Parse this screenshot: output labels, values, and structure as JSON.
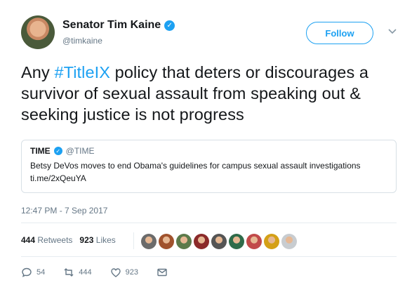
{
  "author": {
    "name": "Senator Tim Kaine",
    "handle": "@timkaine"
  },
  "follow_label": "Follow",
  "tweet": {
    "prefix": "Any ",
    "hashtag": "#TitleIX",
    "suffix": " policy that deters or discourages a survivor of sexual assault from speaking out & seeking justice is not progress"
  },
  "quote": {
    "name": "TIME",
    "handle": "@TIME",
    "text": "Betsy DeVos moves to end Obama's guidelines for campus sexual assault investigations ti.me/2xQeuYA"
  },
  "timestamp": "12:47 PM - 7 Sep 2017",
  "stats": {
    "retweets_count": "444",
    "retweets_label": "Retweets",
    "likes_count": "923",
    "likes_label": "Likes"
  },
  "liker_avatar_colors": [
    "#6b6b6b",
    "#a0522d",
    "#5c7a4a",
    "#8b2a2a",
    "#555555",
    "#2f6b4a",
    "#c14a4a",
    "#d4a017",
    "#c8ccd0"
  ],
  "actions": {
    "reply_count": "54",
    "retweet_count": "444",
    "like_count": "923"
  },
  "colors": {
    "accent": "#1da1f2",
    "muted": "#657786",
    "text": "#14171a"
  }
}
